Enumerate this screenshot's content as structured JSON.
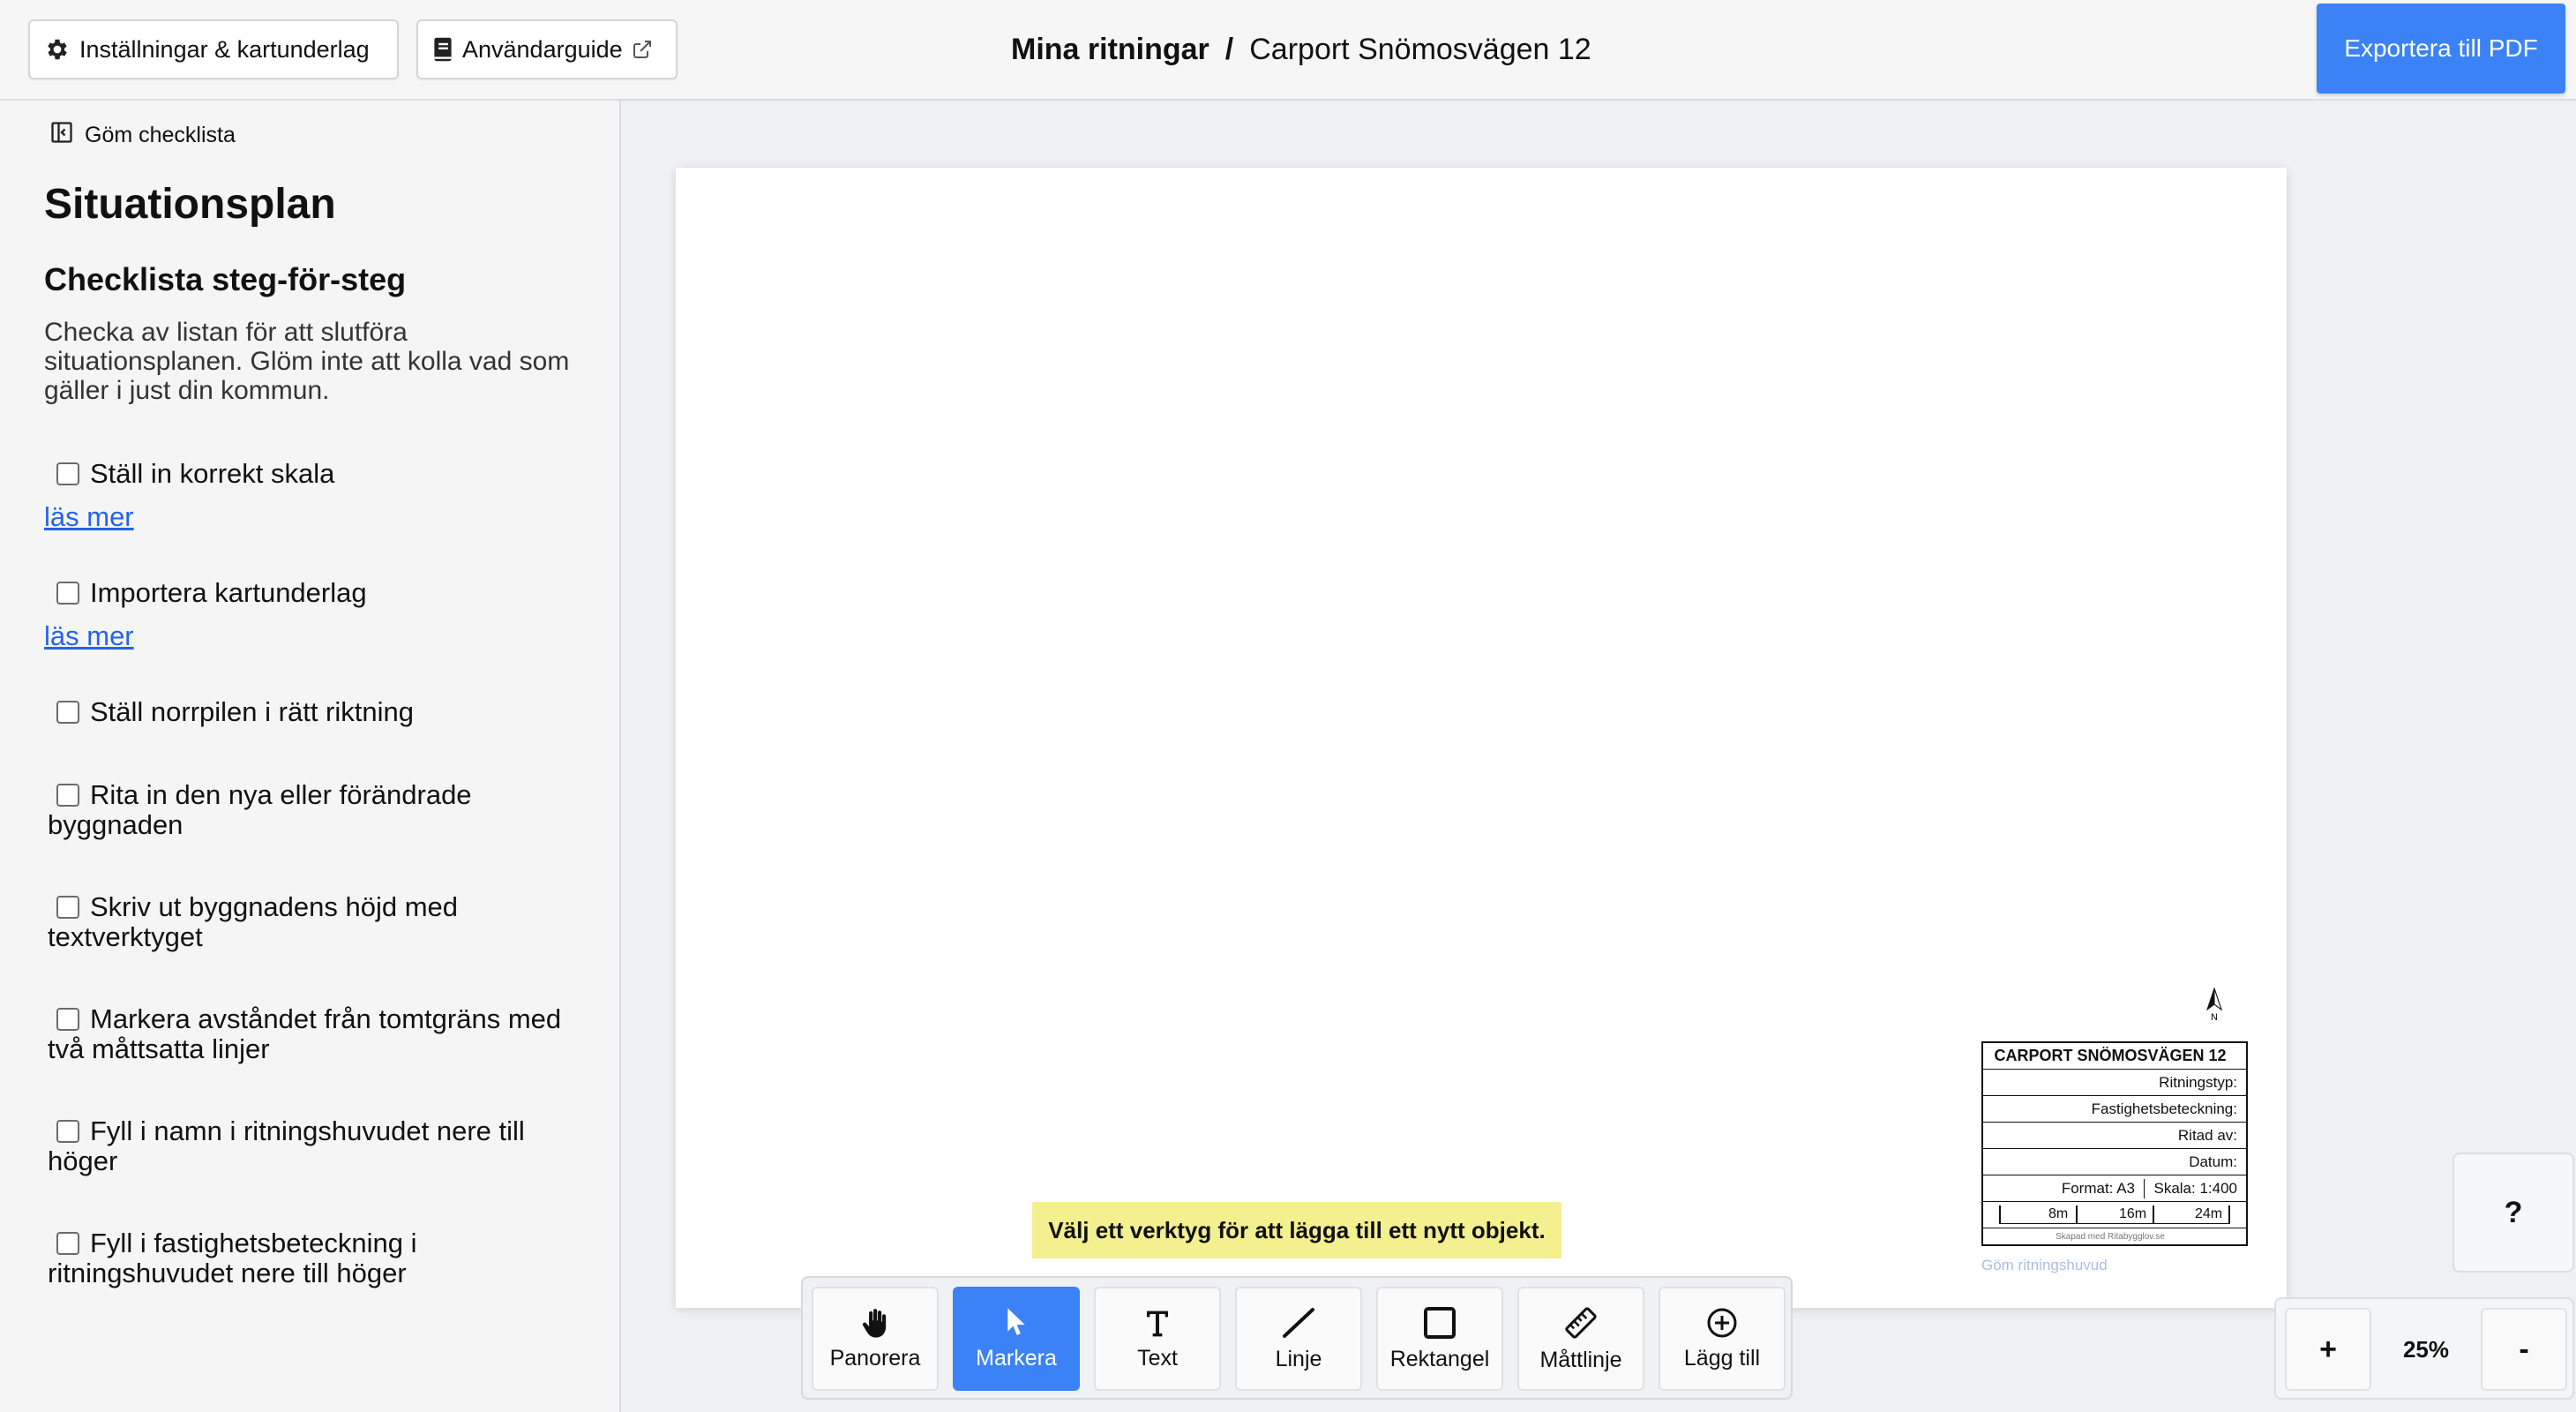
{
  "header": {
    "settings_label": "Inställningar & kartunderlag",
    "guide_label": "Användarguide",
    "breadcrumb_root": "Mina ritningar",
    "breadcrumb_sep": "/",
    "breadcrumb_current": "Carport Snömosvägen 12",
    "export_label": "Exportera till PDF",
    "accent_color": "#3b82f6"
  },
  "sidebar": {
    "hide_label": "Göm checklista",
    "title": "Situationsplan",
    "subtitle": "Checklista steg-för-steg",
    "description": "Checka av listan för att slutföra situationsplanen. Glöm inte att kolla vad som gäller i just din kommun.",
    "read_more": "läs mer",
    "items": [
      {
        "label": "Ställ in korrekt skala",
        "checked": false
      },
      {
        "label": "Importera kartunderlag",
        "checked": false
      },
      {
        "label": "Ställ norrpilen i rätt riktning",
        "checked": false
      },
      {
        "label": "Rita in den nya eller förändrade byggnaden",
        "checked": false
      },
      {
        "label": "Skriv ut byggnadens höjd med textverktyget",
        "checked": false
      },
      {
        "label": "Markera avståndet från tomtgräns med två måttsatta linjer",
        "checked": false
      },
      {
        "label": "Fyll i namn i ritningshuvudet nere till höger",
        "checked": false
      },
      {
        "label": "Fyll i fastighetsbeteckning i ritningshuvudet nere till höger",
        "checked": false
      }
    ]
  },
  "canvas": {
    "north_label": "N",
    "title_block": {
      "title": "CARPORT SNÖMOSVÄGEN 12",
      "drawing_type": "Ritningstyp:",
      "property": "Fastighetsbeteckning:",
      "drawn_by": "Ritad av:",
      "date": "Datum:",
      "format": "Format: A3",
      "scale": "Skala: 1:400",
      "scale_labels": [
        "8m",
        "16m",
        "24m"
      ],
      "credit": "Skapad med Ritabygglov.se"
    },
    "hide_titleblock": "Göm ritningshuvud",
    "hint": "Välj ett verktyg för att lägga till ett nytt objekt."
  },
  "toolbar": {
    "tools": [
      {
        "label": "Panorera",
        "icon": "hand-icon",
        "active": false
      },
      {
        "label": "Markera",
        "icon": "cursor-icon",
        "active": true
      },
      {
        "label": "Text",
        "icon": "text-icon",
        "active": false
      },
      {
        "label": "Linje",
        "icon": "line-icon",
        "active": false
      },
      {
        "label": "Rektangel",
        "icon": "rectangle-icon",
        "active": false
      },
      {
        "label": "Måttlinje",
        "icon": "ruler-icon",
        "active": false
      },
      {
        "label": "Lägg till",
        "icon": "plus-circle-icon",
        "active": false
      }
    ]
  },
  "help": {
    "label": "?"
  },
  "zoom": {
    "plus": "+",
    "value": "25%",
    "minus": "-"
  }
}
